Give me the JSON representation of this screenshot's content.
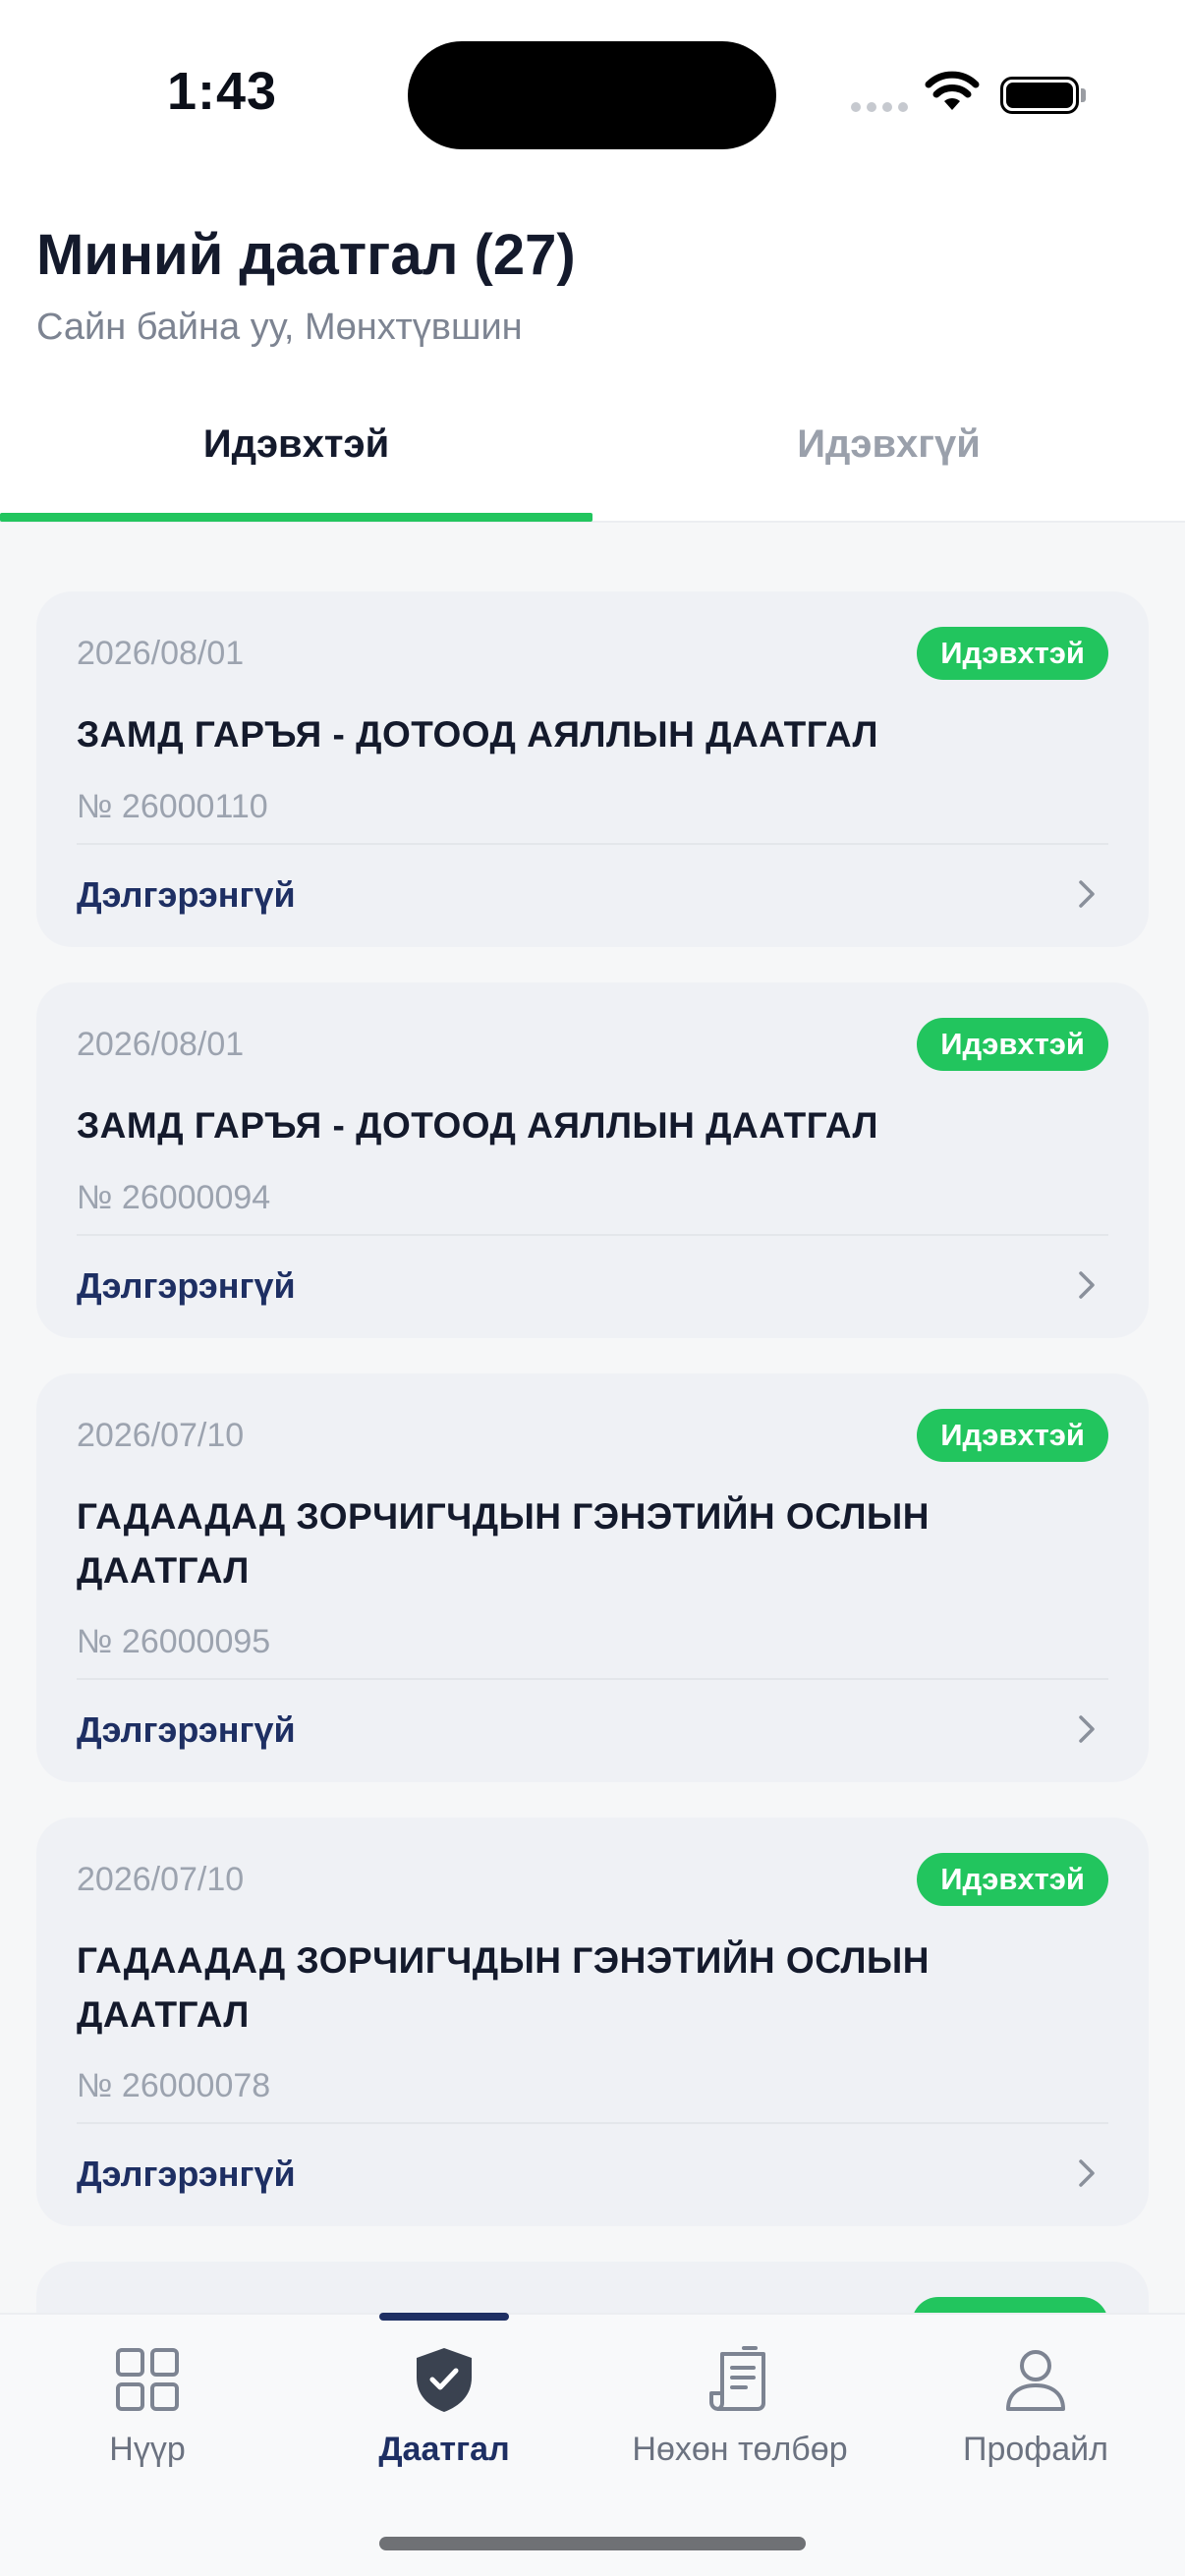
{
  "status_bar": {
    "time": "1:43"
  },
  "header": {
    "title": "Миний даатгал (27)",
    "greeting": "Сайн байна уу, Мөнхтүвшин"
  },
  "tabs": [
    {
      "label": "Идэвхтэй",
      "active": true
    },
    {
      "label": "Идэвхгүй",
      "active": false
    }
  ],
  "policies": [
    {
      "date": "2026/08/01",
      "status": "Идэвхтэй",
      "title": "ЗАМД ГАРЪЯ - ДОТООД АЯЛЛЫН ДААТГАЛ",
      "number": "№ 26000110",
      "link": "Дэлгэрэнгүй"
    },
    {
      "date": "2026/08/01",
      "status": "Идэвхтэй",
      "title": "ЗАМД ГАРЪЯ - ДОТООД АЯЛЛЫН ДААТГАЛ",
      "number": "№ 26000094",
      "link": "Дэлгэрэнгүй"
    },
    {
      "date": "2026/07/10",
      "status": "Идэвхтэй",
      "title": "ГАДААДАД ЗОРЧИГЧДЫН ГЭНЭТИЙН ОСЛЫН ДААТГАЛ",
      "number": "№ 26000095",
      "link": "Дэлгэрэнгүй"
    },
    {
      "date": "2026/07/10",
      "status": "Идэвхтэй",
      "title": "ГАДААДАД ЗОРЧИГЧДЫН ГЭНЭТИЙН ОСЛЫН ДААТГАЛ",
      "number": "№ 26000078",
      "link": "Дэлгэрэнгүй"
    }
  ],
  "bottom_nav": [
    {
      "label": "Нүүр",
      "icon": "grid-icon",
      "active": false
    },
    {
      "label": "Даатгал",
      "icon": "shield-check-icon",
      "active": true
    },
    {
      "label": "Нөхөн төлбөр",
      "icon": "receipt-icon",
      "active": false
    },
    {
      "label": "Профайл",
      "icon": "user-icon",
      "active": false
    }
  ],
  "colors": {
    "accent_green": "#22c55e",
    "primary_navy": "#1e2f63",
    "title_dark": "#141a2c",
    "muted_gray": "#9ca3af"
  }
}
